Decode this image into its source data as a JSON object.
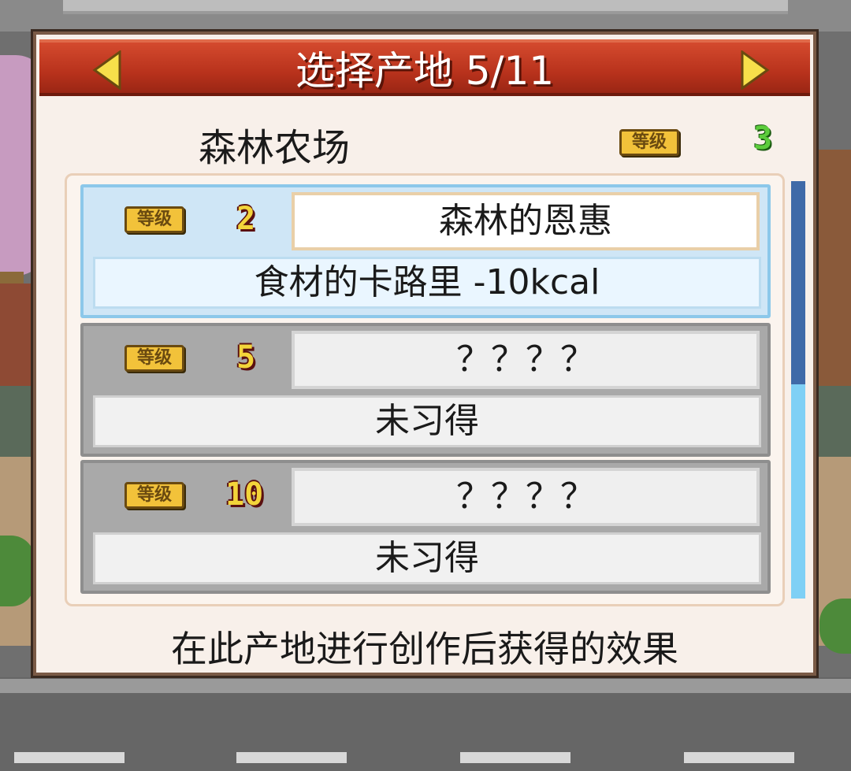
{
  "header": {
    "title": "选择产地 5/11",
    "prev_icon": "arrow-left-icon",
    "next_icon": "arrow-right-icon"
  },
  "farm": {
    "name": "森林农场",
    "level_badge": "等级",
    "level": "3"
  },
  "perks": [
    {
      "level_badge": "等级",
      "level": "2",
      "name": "森林的恩惠",
      "description": "食材的卡路里 -10kcal",
      "unlocked": true
    },
    {
      "level_badge": "等级",
      "level": "5",
      "name": "？？？？",
      "description": "未习得",
      "unlocked": false
    },
    {
      "level_badge": "等级",
      "level": "10",
      "name": "？？？？",
      "description": "未习得",
      "unlocked": false
    }
  ],
  "footer": {
    "note": "在此产地进行创作后获得的效果"
  },
  "colors": {
    "header_red": "#b8321c",
    "badge_gold": "#f2c23a",
    "level_green": "#5ccc3c",
    "active_row": "#cfe6f6",
    "locked_row": "#a9a9a9",
    "scroll_thumb": "#3f6aa8"
  }
}
